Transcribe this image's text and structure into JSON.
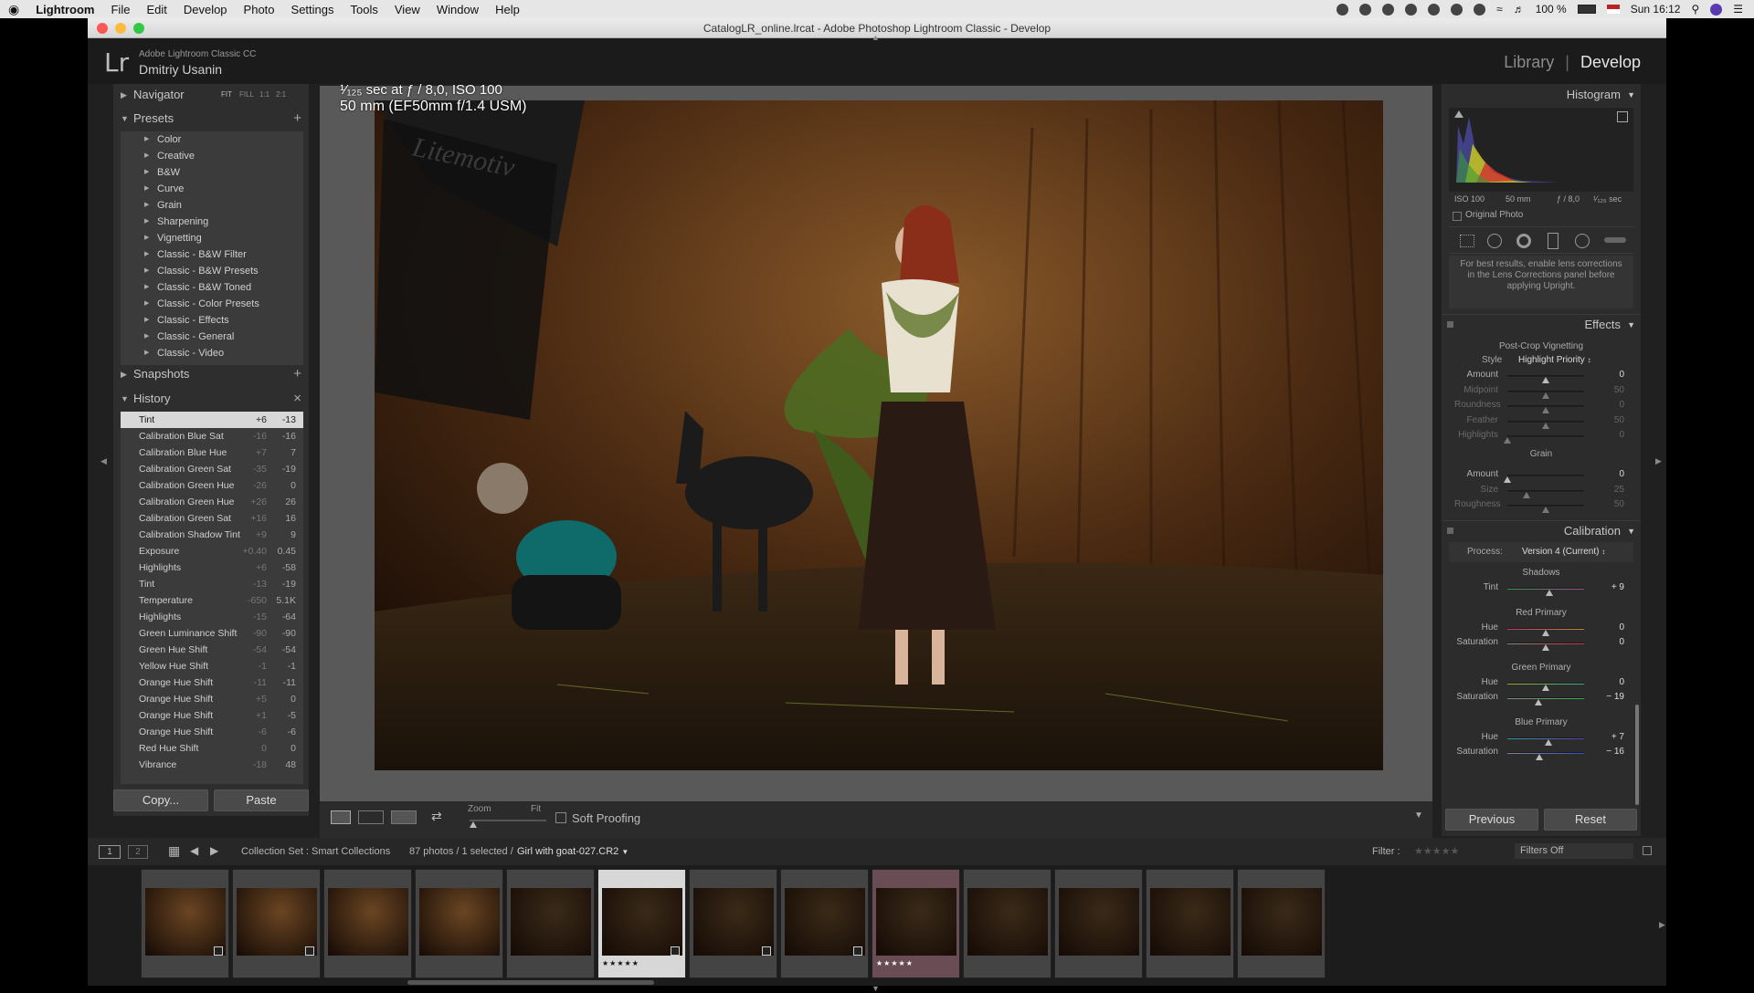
{
  "menubar": {
    "apple": "",
    "app": "Lightroom",
    "items": [
      "File",
      "Edit",
      "Develop",
      "Photo",
      "Settings",
      "Tools",
      "View",
      "Window",
      "Help"
    ],
    "battery": "100 %",
    "clock": "Sun 16:12"
  },
  "window": {
    "title": "CatalogLR_online.lrcat - Adobe Photoshop Lightroom Classic - Develop"
  },
  "identity": {
    "logo": "Lr",
    "product": "Adobe Lightroom Classic CC",
    "user": "Dmitriy Usanin",
    "modules": [
      "Library",
      "Develop"
    ],
    "separator": "|"
  },
  "left": {
    "navigator": {
      "label": "Navigator",
      "zoom_options": [
        "FIT",
        "FILL",
        "1:1",
        "2:1"
      ]
    },
    "presets": {
      "label": "Presets",
      "add": "+",
      "items": [
        "Color",
        "Creative",
        "B&W",
        "Curve",
        "Grain",
        "Sharpening",
        "Vignetting",
        "Classic - B&W Filter",
        "Classic - B&W Presets",
        "Classic - B&W Toned",
        "Classic - Color Presets",
        "Classic - Effects",
        "Classic - General",
        "Classic - Video"
      ]
    },
    "snapshots": {
      "label": "Snapshots",
      "add": "+"
    },
    "history": {
      "label": "History",
      "clear": "×",
      "items": [
        {
          "name": "Tint",
          "delta": "+6",
          "value": "-13"
        },
        {
          "name": "Calibration Blue Sat",
          "delta": "-16",
          "value": "-16"
        },
        {
          "name": "Calibration Blue Hue",
          "delta": "+7",
          "value": "7"
        },
        {
          "name": "Calibration Green Sat",
          "delta": "-35",
          "value": "-19"
        },
        {
          "name": "Calibration Green Hue",
          "delta": "-26",
          "value": "0"
        },
        {
          "name": "Calibration Green Hue",
          "delta": "+26",
          "value": "26"
        },
        {
          "name": "Calibration Green Sat",
          "delta": "+16",
          "value": "16"
        },
        {
          "name": "Calibration Shadow Tint",
          "delta": "+9",
          "value": "9"
        },
        {
          "name": "Exposure",
          "delta": "+0.40",
          "value": "0.45"
        },
        {
          "name": "Highlights",
          "delta": "+6",
          "value": "-58"
        },
        {
          "name": "Tint",
          "delta": "-13",
          "value": "-19"
        },
        {
          "name": "Temperature",
          "delta": "-650",
          "value": "5.1K"
        },
        {
          "name": "Highlights",
          "delta": "-15",
          "value": "-64"
        },
        {
          "name": "Green Luminance Shift",
          "delta": "-90",
          "value": "-90"
        },
        {
          "name": "Green Hue Shift",
          "delta": "-54",
          "value": "-54"
        },
        {
          "name": "Yellow Hue Shift",
          "delta": "-1",
          "value": "-1"
        },
        {
          "name": "Orange Hue Shift",
          "delta": "-11",
          "value": "-11"
        },
        {
          "name": "Orange Hue Shift",
          "delta": "+5",
          "value": "0"
        },
        {
          "name": "Orange Hue Shift",
          "delta": "+1",
          "value": "-5"
        },
        {
          "name": "Orange Hue Shift",
          "delta": "-6",
          "value": "-6"
        },
        {
          "name": "Red Hue Shift",
          "delta": "0",
          "value": "0"
        },
        {
          "name": "Vibrance",
          "delta": "-18",
          "value": "48"
        }
      ]
    },
    "copy_label": "Copy...",
    "paste_label": "Paste"
  },
  "image": {
    "info_line1": "¹⁄₁₂₅ sec at ƒ / 8,0, ISO 100",
    "info_line2": "50 mm (EF50mm f/1.4 USM)",
    "backdrop_text": "Litemotiv"
  },
  "toolbar": {
    "zoom_label": "Zoom",
    "fit_label": "Fit",
    "soft_proofing": "Soft Proofing"
  },
  "right": {
    "histogram": {
      "label": "Histogram",
      "iso": "ISO 100",
      "focal": "50 mm",
      "aperture": "ƒ / 8,0",
      "shutter": "¹⁄₁₂₅ sec",
      "original_photo": "Original Photo"
    },
    "upright_note": "For best results, enable lens corrections in the Lens Corrections panel before applying Upright.",
    "effects": {
      "label": "Effects",
      "vignette_title": "Post-Crop Vignetting",
      "style_label": "Style",
      "style_value": "Highlight Priority",
      "vignette_sliders": [
        {
          "label": "Amount",
          "value": "0",
          "pos": 0.5,
          "dim": false
        },
        {
          "label": "Midpoint",
          "value": "50",
          "pos": 0.5,
          "dim": true
        },
        {
          "label": "Roundness",
          "value": "0",
          "pos": 0.5,
          "dim": true
        },
        {
          "label": "Feather",
          "value": "50",
          "pos": 0.5,
          "dim": true
        },
        {
          "label": "Highlights",
          "value": "0",
          "pos": 0.0,
          "dim": true
        }
      ],
      "grain_title": "Grain",
      "grain_sliders": [
        {
          "label": "Amount",
          "value": "0",
          "pos": 0.0,
          "dim": false
        },
        {
          "label": "Size",
          "value": "25",
          "pos": 0.25,
          "dim": true
        },
        {
          "label": "Roughness",
          "value": "50",
          "pos": 0.5,
          "dim": true
        }
      ]
    },
    "calibration": {
      "label": "Calibration",
      "process_label": "Process:",
      "process_value": "Version 4 (Current)",
      "groups": [
        {
          "title": "Shadows",
          "sliders": [
            {
              "label": "Tint",
              "value": "+ 9",
              "pos": 0.55,
              "grad": "linear-gradient(90deg,#3a9a4a,#a04aa0)"
            }
          ]
        },
        {
          "title": "Red Primary",
          "sliders": [
            {
              "label": "Hue",
              "value": "0",
              "pos": 0.5,
              "grad": "linear-gradient(90deg,#c03a6a,#c08a3a)"
            },
            {
              "label": "Saturation",
              "value": "0",
              "pos": 0.5,
              "grad": "linear-gradient(90deg,#888,#d03030)"
            }
          ]
        },
        {
          "title": "Green Primary",
          "sliders": [
            {
              "label": "Hue",
              "value": "0",
              "pos": 0.5,
              "grad": "linear-gradient(90deg,#a0b030,#30b08a)"
            },
            {
              "label": "Saturation",
              "value": "− 19",
              "pos": 0.4,
              "grad": "linear-gradient(90deg,#888,#30b040)"
            }
          ]
        },
        {
          "title": "Blue Primary",
          "sliders": [
            {
              "label": "Hue",
              "value": "+ 7",
              "pos": 0.54,
              "grad": "linear-gradient(90deg,#30a0a0,#6040c0)"
            },
            {
              "label": "Saturation",
              "value": "− 16",
              "pos": 0.42,
              "grad": "linear-gradient(90deg,#888,#3050d0)"
            }
          ]
        }
      ]
    },
    "previous_label": "Previous",
    "reset_label": "Reset"
  },
  "filmstrip": {
    "screen1": "1",
    "screen2": "2",
    "source": "Collection Set : Smart Collections",
    "count": "87 photos / 1 selected /",
    "filename": "Girl with goat-027.CR2",
    "filter_label": "Filter :",
    "filter_value": "Filters Off",
    "stars": "★★★★★",
    "thumb_stars": "★★★★★",
    "thumb_count": 13
  }
}
